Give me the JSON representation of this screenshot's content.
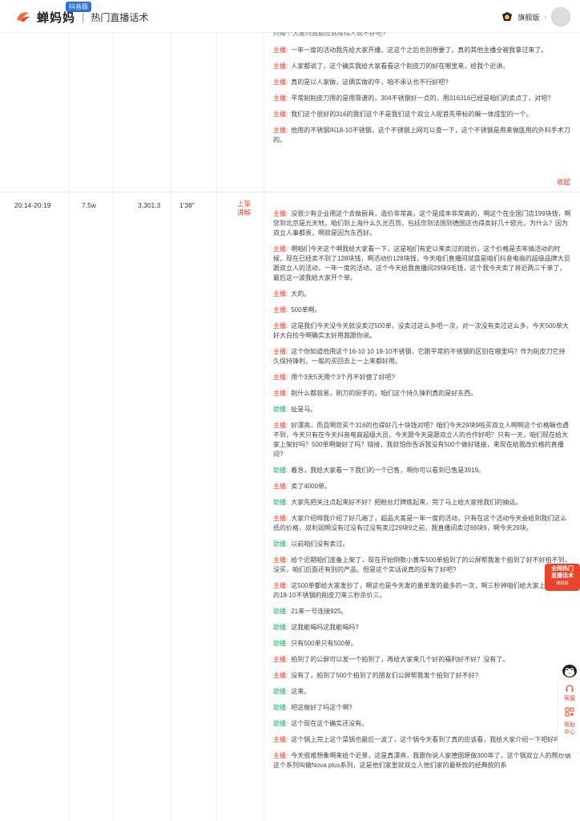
{
  "header": {
    "logo_text": "蝉妈妈",
    "logo_badge": "抖音版",
    "separator": "|",
    "subtitle": "热门直播话术",
    "user_name": "旗舰版",
    "user_chevron": "›"
  },
  "top_fragment": "问每个大是问我都应就啥得人说不好吧?",
  "block1": {
    "lines": [
      {
        "role": "主播:",
        "role_type": "host",
        "text": "一年一度的活动我先给大家开播，这这个之后也别想要了，真的其他主播全被我拿过来了。"
      },
      {
        "role": "主播:",
        "role_type": "host",
        "text": "人家都说了，这个确实我给大家看看这个削皮刀的好在哪里来，给我个近讲。"
      },
      {
        "role": "主播:",
        "role_type": "host",
        "text": "真的是以人家做，这俩实做的牛，咱不承认也不行好吧?"
      },
      {
        "role": "主播:",
        "role_type": "host",
        "text": "平常削削皮刀用的是用靠谱的，304不锈钢好一点的，用316316已经是咱们的卖点了，对吧?"
      },
      {
        "role": "主播:",
        "role_type": "host",
        "text": "我们这个很好的316的我们这个不是我们这个双立人呢首先带标的嘛一体成型的一个。"
      },
      {
        "role": "主播:",
        "role_type": "host",
        "text": "他用的不锈钢叫18-10不锈钢，这个不锈钢上网可以查一下，这个不锈钢是用来做医用的外科手术刀的。"
      }
    ],
    "collapse_label": "收起"
  },
  "block2": {
    "time": "20:14-20:19",
    "viewers": "7.5w",
    "sales": "3,301.3",
    "duration": "1'38\"",
    "tag": "上架讲解",
    "lines": [
      {
        "role": "主播:",
        "role_type": "host",
        "text": "没很少有企业用这个去做厨具，造价非常高，这个是成本非常高的，啊这个在全国门店199块钱，啊您到北京是光天地，咱们到上海什么久光百货，包括您到法国到德国这也得卖好几十欧元，为什么？因为双立人事都贵，啊就是因为东西好。"
      },
      {
        "role": "主播:",
        "role_type": "host",
        "text": "啊咱们今天这个啊我给大家看一下，这是咱们有史以来卖过的底价，这个价格是去年搞活动的时候，现在已经卖不到了128块钱，啊活动价128块钱，今天咱们直播间就盘是咱们抖音电商的超级品牌大员跟双立人的活动，一年一度的活动，这个今天给我直播间29块9毛钱，这个我今天卖了将近两三千单了，最后这一波我给大家开个单。"
      },
      {
        "role": "主播:",
        "role_type": "host",
        "text": "大的。"
      },
      {
        "role": "主播:",
        "role_type": "host",
        "text": "500单啊。"
      },
      {
        "role": "主播:",
        "role_type": "host",
        "text": "这是我们今天没今天就没卖过500单，没卖过这么多吧一次，对一次没有卖过这么多，今天500单大好大白捡今啊确实太好用我跟你说。"
      },
      {
        "role": "主播:",
        "role_type": "host",
        "text": "这个你知道他用这个16-10 10 18-10不锈钢，它跟平常的不锈钢的区别在哪里吗？作为削皮刀它持久保持锋利，一般的买回去上一上来都好用。"
      },
      {
        "role": "主播:",
        "role_type": "host",
        "text": "用个3天5天用个3个月不好使了好吧?"
      },
      {
        "role": "主播:",
        "role_type": "host",
        "text": "削什么都容易，刚刀的挺手的，咱们这个持久锋利真的是好东西。"
      },
      {
        "role": "助播:",
        "role_type": "assist",
        "text": "扯是马。"
      },
      {
        "role": "主播:",
        "role_type": "host",
        "text": "好漂亮，而且啊您买个316的也得好几十块钱对吧？咱们今天29块9啦买双立人啊啊这个价格嘛也遇不到，今天只有在今天抖音电商超级大员，今天跟今天是跟双立人的合作好吧？只有一天，咱们现在给大家上架好吗？500单啊做好了吗？链接，我就怕你告诉我没有500个做好链接，来现在给我改价格的直播间?"
      },
      {
        "role": "助播:",
        "role_type": "assist",
        "text": "着急，我给大家看一下我们的一个已售，啊你可以看到已售是3919。"
      },
      {
        "role": "主播:",
        "role_type": "host",
        "text": "卖了4000单。"
      },
      {
        "role": "助播:",
        "role_type": "assist",
        "text": "大家先把关注点起来好不好？把粉丝灯牌练起来，完了马上给大家抢我们的抽话。"
      },
      {
        "role": "主播:",
        "role_type": "host",
        "text": "大家介绍啡我介绍了好几遍了，超品大差是一年一度的活动，只有在这个活动今天会给到我们这么低的价格，双利润啊没有过没有过没有卖过29块9之前，我直播间卖过69块9，啊今天29块。"
      },
      {
        "role": "助播:",
        "role_type": "assist",
        "text": "以前咱们没有卖过。"
      },
      {
        "role": "主播:",
        "role_type": "host",
        "text": "给个近期咱们准备上架了，现在开始倒数小黄车500单拍到了的公屏帮我发个拍到了好不好拍不到，没买，咱们后面还有别的产品，但是这个实话说真的没有了好吧?"
      },
      {
        "role": "主播:",
        "role_type": "host",
        "text": "这500单都给大家发抄了，啊这也是今天发的量单发的最多的一次，啊三秒钟咱们给大家上架双立人的18-10不锈钢的削皮刀来三秒杀价三。"
      },
      {
        "role": "助播:",
        "role_type": "assist",
        "text": "21来一号连接925。"
      },
      {
        "role": "助播:",
        "role_type": "assist",
        "text": "这我能喝吗这我能喝吗?"
      },
      {
        "role": "助播:",
        "role_type": "assist",
        "text": "只有500单只有500单。"
      },
      {
        "role": "主播:",
        "role_type": "host",
        "text": "拍到了的公屏可以发一个拍到了，再给大家来几个好的福利好不好？没有了。"
      },
      {
        "role": "主播:",
        "role_type": "host",
        "text": "没有了，拍到了500个拍到了的朋友们公屏帮我发个拍到了好不好?"
      },
      {
        "role": "助播:",
        "role_type": "assist",
        "text": "这来。"
      },
      {
        "role": "助播:",
        "role_type": "assist",
        "text": "吧这做好了吗这个啊?"
      },
      {
        "role": "助播:",
        "role_type": "assist",
        "text": "这个现在这个确实还没有。"
      },
      {
        "role": "主播:",
        "role_type": "host",
        "text": "这个锅上完上这个菜锅也最后一波了，这个锅今天看到了真的应该看，我给大家介绍一下吧好吗?"
      },
      {
        "role": "主播:",
        "role_type": "host",
        "text": "今天很难想象啊来给个近景，这是真漂亮，我跟你说人家德国原做300年了，这个锅双立人的熊炒锅这个系列叫做Nova plus系列，这是他们家里就双立人他们家的最新款的经典款的系"
      }
    ]
  },
  "float_card": {
    "line1": "全网热门",
    "line2": "直播话术",
    "small": "蝉妈妈"
  },
  "sidebar": {
    "service": "客服",
    "qr": "",
    "help": "帮助中心"
  }
}
